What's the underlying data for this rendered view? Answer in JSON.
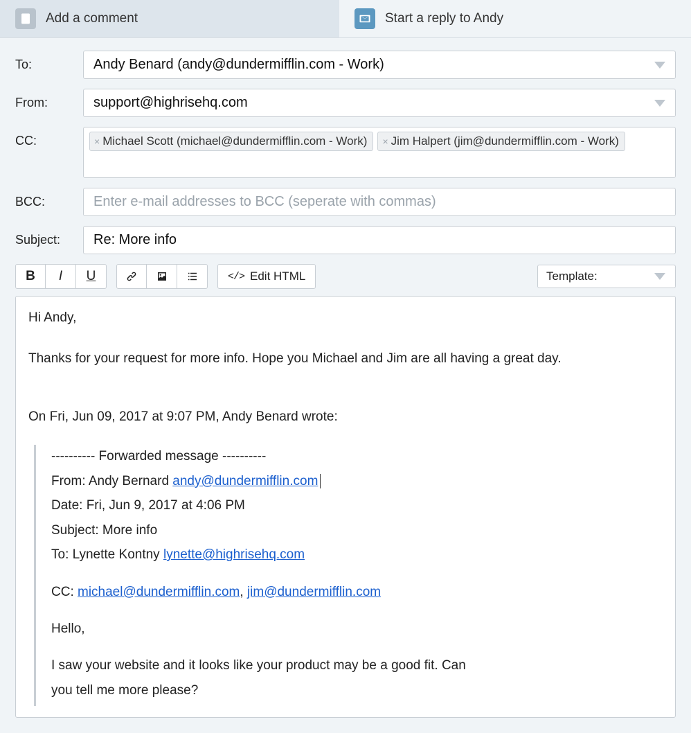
{
  "tabs": {
    "comment": "Add a comment",
    "reply": "Start a reply to Andy"
  },
  "labels": {
    "to": "To:",
    "from": "From:",
    "cc": "CC:",
    "bcc": "BCC:",
    "subject": "Subject:"
  },
  "to": "Andy Benard (andy@dundermifflin.com - Work)",
  "from": "support@highrisehq.com",
  "cc": [
    "Michael Scott (michael@dundermifflin.com - Work)",
    "Jim Halpert (jim@dundermifflin.com - Work)"
  ],
  "bcc_placeholder": "Enter e-mail addresses to BCC (seperate with commas)",
  "subject": "Re: More info",
  "toolbar": {
    "edit_html": "Edit HTML",
    "template_label": "Template:"
  },
  "body": {
    "greeting": "Hi Andy,",
    "line1": "Thanks for your request for more info. Hope you Michael and Jim are all having a great day.",
    "quote_intro": "On Fri, Jun 09, 2017 at 9:07 PM, Andy Benard wrote:",
    "fwd_header": "---------- Forwarded message ----------",
    "fwd_from_label": "From: Andy Bernard ",
    "fwd_from_email": "andy@dundermifflin.com",
    "fwd_date": "Date: Fri, Jun 9, 2017 at 4:06 PM",
    "fwd_subject": "Subject: More info",
    "fwd_to_label": "To: Lynette Kontny ",
    "fwd_to_email": "lynette@highrisehq.com",
    "fwd_cc_label": "CC: ",
    "fwd_cc_1": "michael@dundermifflin.com",
    "fwd_cc_sep": ", ",
    "fwd_cc_2": "jim@dundermifflin.com",
    "quoted_hello": "Hello,",
    "quoted_body1": "I saw your website and it looks like your product may be a good fit. Can",
    "quoted_body2": "you tell me more please?"
  }
}
